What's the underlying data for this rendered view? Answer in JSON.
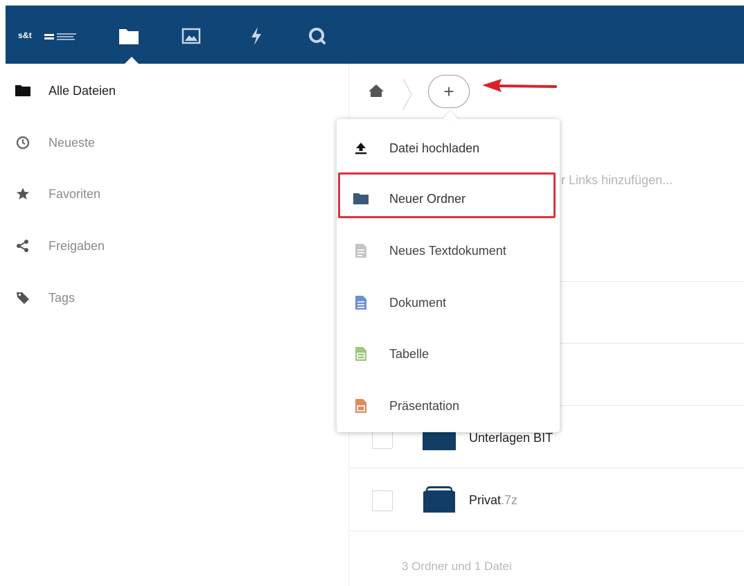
{
  "topbar": {
    "brand": "s&t",
    "accent": "#0f4577",
    "apps": [
      {
        "icon": "files-icon"
      },
      {
        "icon": "gallery-icon"
      },
      {
        "icon": "activity-icon"
      },
      {
        "icon": "search-icon"
      }
    ]
  },
  "sidebar": {
    "items": [
      {
        "label": "Alle Dateien",
        "icon": "folder-icon",
        "active": true
      },
      {
        "label": "Neueste",
        "icon": "clock-icon"
      },
      {
        "label": "Favoriten",
        "icon": "star-icon"
      },
      {
        "label": "Freigaben",
        "icon": "share-icon"
      },
      {
        "label": "Tags",
        "icon": "tag-icon"
      }
    ]
  },
  "breadcrumb": {
    "home_icon": "home-icon",
    "add_icon": "plus-icon",
    "add_label": "+"
  },
  "menu": {
    "items": [
      {
        "label": "Datei hochladen",
        "icon": "upload-icon"
      },
      {
        "label": "Neuer Ordner",
        "icon": "folder-icon",
        "highlighted": true,
        "highlight_color": "#d9333c"
      },
      {
        "label": "Neues Textdokument",
        "icon": "text-document-icon"
      },
      {
        "label": "Dokument",
        "icon": "document-icon"
      },
      {
        "label": "Tabelle",
        "icon": "spreadsheet-icon"
      },
      {
        "label": "Präsentation",
        "icon": "presentation-icon"
      }
    ]
  },
  "background_text": "r Links hinzufügen...",
  "files": [
    {
      "name": "Unterlagen BIT",
      "ext": "",
      "icon": "folder-icon"
    },
    {
      "name": "Privat",
      "ext": ".7z",
      "icon": "archive-icon"
    }
  ],
  "summary": "3 Ordner und 1 Datei",
  "annotation": {
    "arrow_color": "#d9232a"
  }
}
